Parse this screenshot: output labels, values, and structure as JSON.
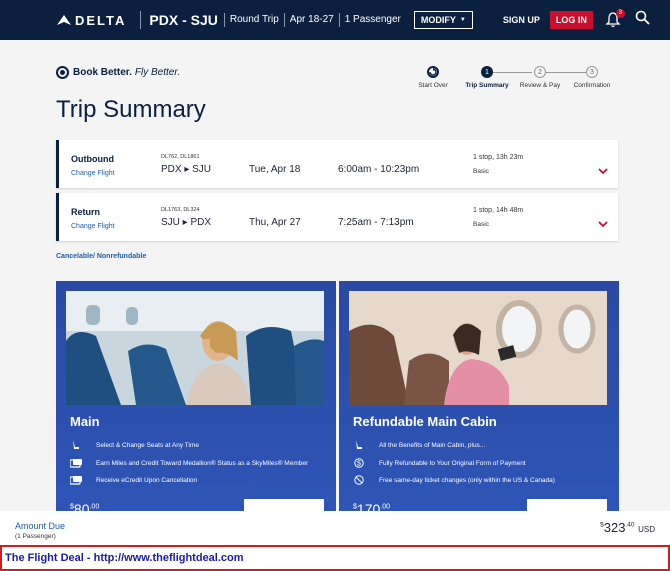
{
  "header": {
    "brand": "DELTA",
    "route": "PDX - SJU",
    "trip_type": "Round Trip",
    "dates": "Apr 18-27",
    "passengers": "1 Passenger",
    "modify_label": "MODIFY",
    "signup_label": "SIGN UP",
    "login_label": "LOG IN",
    "notification_count": "3"
  },
  "tagline": {
    "bold": "Book Better.",
    "italic": "Fly Better."
  },
  "page_title": "Trip Summary",
  "steps": [
    {
      "label": "Start Over",
      "number": "",
      "state": "done"
    },
    {
      "label": "Trip Summary",
      "number": "1",
      "state": "active"
    },
    {
      "label": "Review & Pay",
      "number": "2",
      "state": "todo"
    },
    {
      "label": "Confirmation",
      "number": "3",
      "state": "todo"
    }
  ],
  "flights": [
    {
      "direction": "Outbound",
      "change_label": "Change Flight",
      "flight_numbers": "DL762, DL1861",
      "route": "PDX ▸ SJU",
      "date": "Tue, Apr 18",
      "time": "6:00am - 10:23pm",
      "stops": "1 stop, 13h 23m",
      "fare": "Basic"
    },
    {
      "direction": "Return",
      "change_label": "Change Flight",
      "flight_numbers": "DL1763, DL324",
      "route": "SJU ▸ PDX",
      "date": "Thu, Apr 27",
      "time": "7:25am - 7:13pm",
      "stops": "1 stop, 14h 48m",
      "fare": "Basic"
    }
  ],
  "cancel_policy": "Cancelable/ Nonrefundable",
  "cards": [
    {
      "title": "Main",
      "features": [
        {
          "icon": "seat-icon",
          "text": "Select & Change Seats at Any Time"
        },
        {
          "icon": "miles-icon",
          "text": "Earn Miles and Credit Toward Medallion® Status as a SkyMiles® Member"
        },
        {
          "icon": "ecredit-icon",
          "text": "Receive eCredit Upon Cancellation"
        }
      ],
      "price_currency": "$",
      "price_whole": "80",
      "price_cents": ".00"
    },
    {
      "title": "Refundable Main Cabin",
      "features": [
        {
          "icon": "seat-icon",
          "text": "All the Benefits of Main Cabin, plus..."
        },
        {
          "icon": "dollar-icon",
          "text": "Fully Refundable to Your Original Form of Payment"
        },
        {
          "icon": "no-fee-icon",
          "text": "Free same-day ticket changes (only within the US & Canada)"
        }
      ],
      "price_currency": "$",
      "price_whole": "170",
      "price_cents": ".00"
    }
  ],
  "amount_due": {
    "label": "Amount Due",
    "passengers": "(1 Passenger)",
    "currency_symbol": "$",
    "whole": "323",
    "cents": ".40",
    "currency": "USD"
  },
  "deal_banner": "The Flight Deal - http://www.theflightdeal.com",
  "colors": {
    "navy": "#0b1f3f",
    "red": "#c8102e",
    "card_blue": "#2e55b8",
    "link_blue": "#2060a8"
  }
}
